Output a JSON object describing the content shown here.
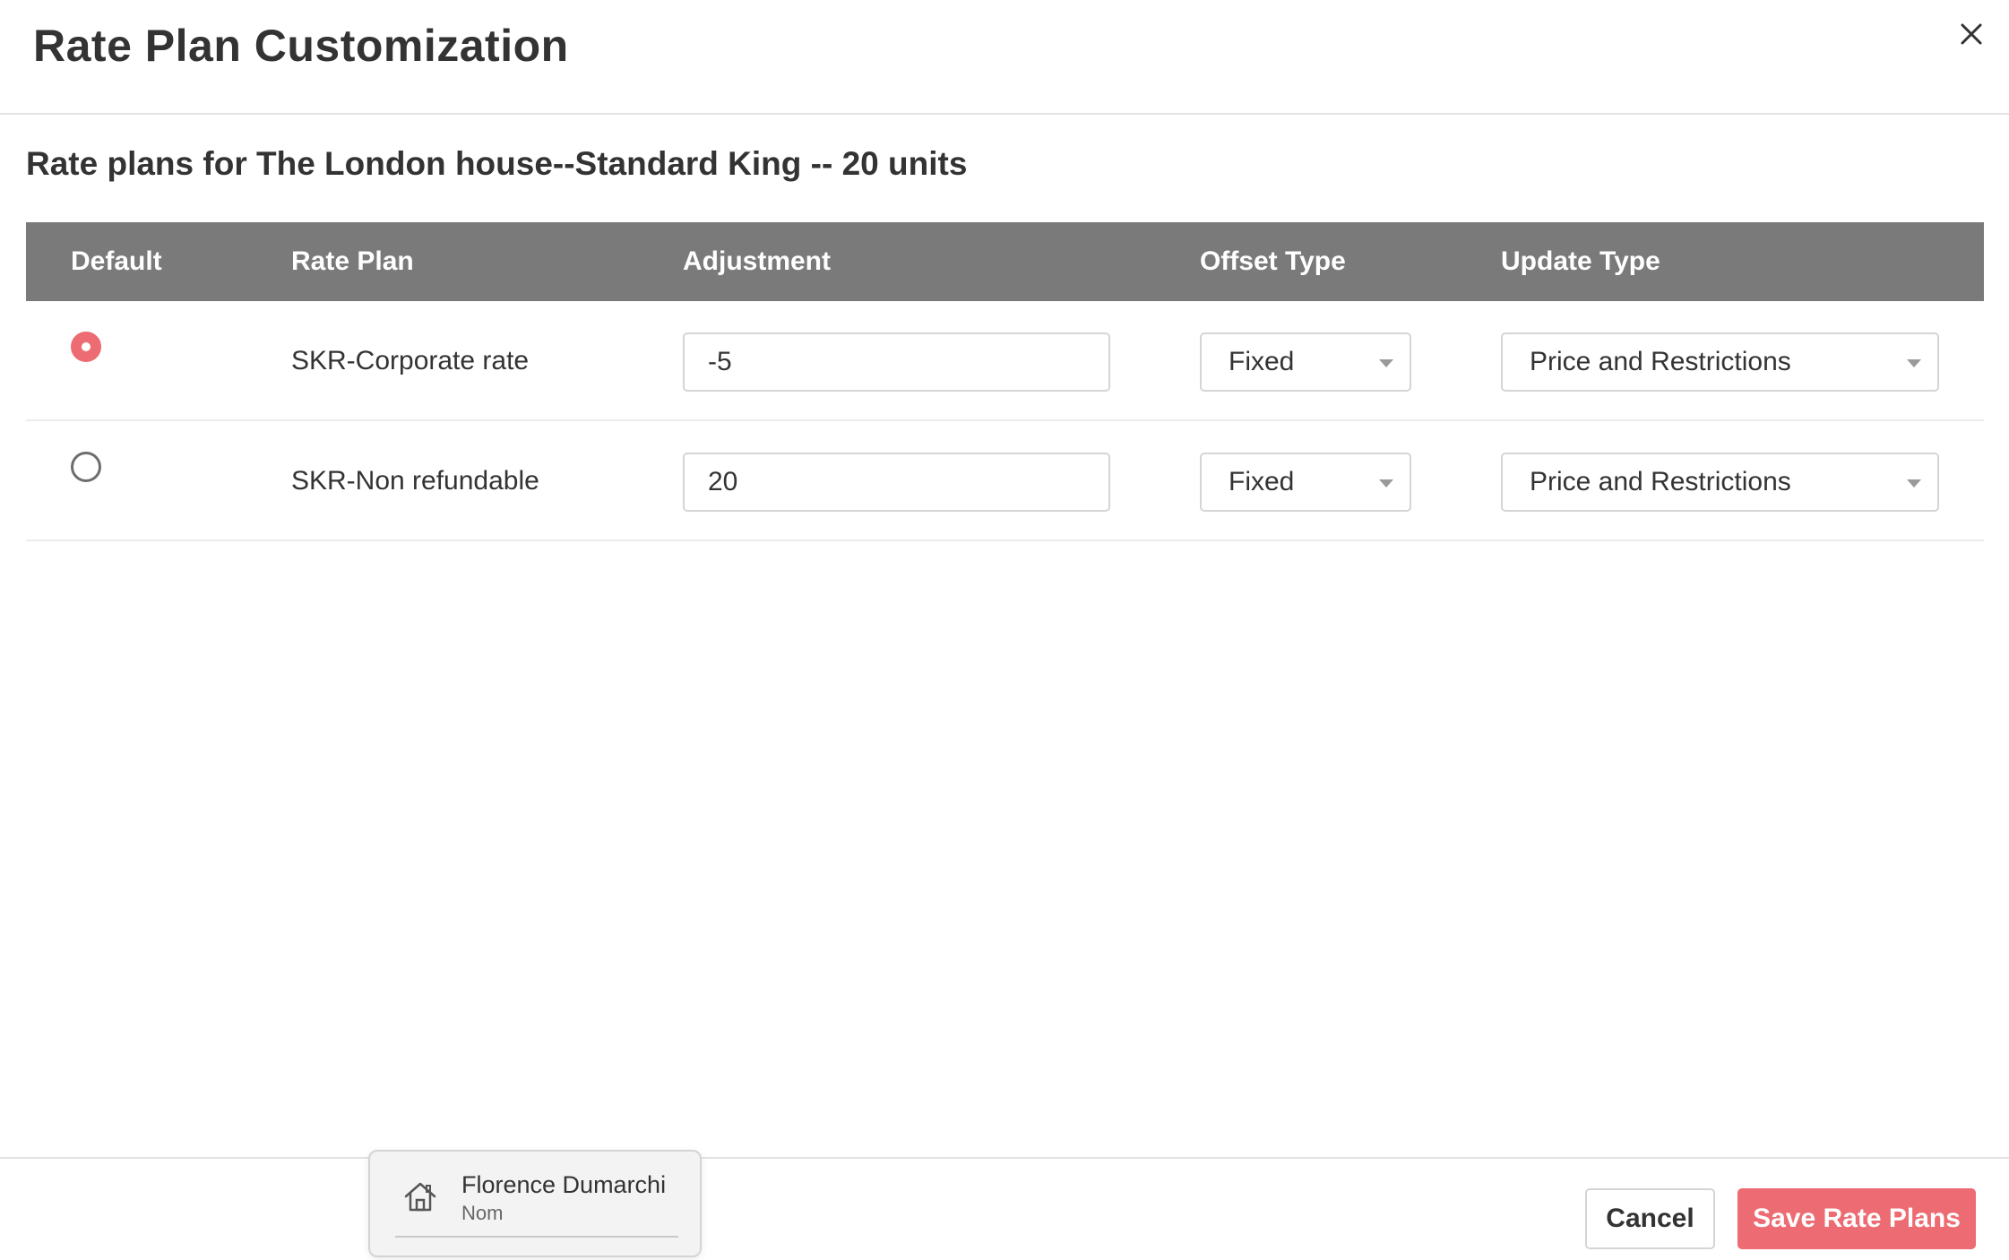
{
  "modal": {
    "title": "Rate Plan Customization"
  },
  "section": {
    "title": "Rate plans for The London house--Standard King -- 20 units"
  },
  "table": {
    "columns": {
      "default": "Default",
      "rate_plan": "Rate Plan",
      "adjustment": "Adjustment",
      "offset_type": "Offset Type",
      "update_type": "Update Type"
    },
    "rows": [
      {
        "is_default": true,
        "rate_plan": "SKR-Corporate rate",
        "adjustment": "-5",
        "offset_type": "Fixed",
        "update_type": "Price and Restrictions"
      },
      {
        "is_default": false,
        "rate_plan": "SKR-Non refundable",
        "adjustment": "20",
        "offset_type": "Fixed",
        "update_type": "Price and Restrictions"
      }
    ]
  },
  "footer": {
    "cancel_label": "Cancel",
    "save_label": "Save Rate Plans"
  },
  "user_card": {
    "name": "Florence Dumarchi",
    "role": "Nom",
    "icon": "home-icon"
  },
  "colors": {
    "accent": "#ed6b72",
    "table_header": "#7a7a7a"
  },
  "icons": {
    "close": "close-icon",
    "dropdown": "chevron-down-icon",
    "radio_selected": "radio-selected-icon",
    "radio_unselected": "radio-unselected-icon"
  }
}
